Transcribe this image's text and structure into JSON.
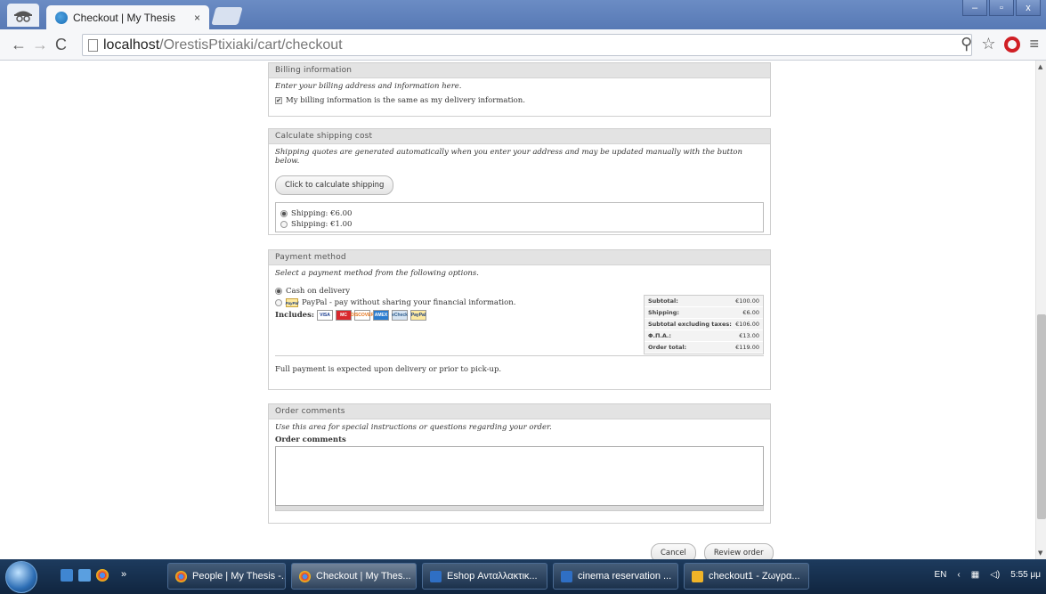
{
  "browser": {
    "tab_title": "Checkout | My Thesis",
    "tab_close": "×",
    "url_host": "localhost",
    "url_path": "/OrestisPtixiaki/cart/checkout",
    "win_min": "–",
    "win_max": "▫",
    "win_close": "x"
  },
  "billing": {
    "legend": "Billing information",
    "description": "Enter your billing address and information here.",
    "same_as_delivery": "My billing information is the same as my delivery information."
  },
  "shipping": {
    "legend": "Calculate shipping cost",
    "description": "Shipping quotes are generated automatically when you enter your address and may be updated manually with the button below.",
    "button": "Click to calculate shipping",
    "options": [
      {
        "label": "Shipping: €6.00",
        "selected": true
      },
      {
        "label": "Shipping: €1.00",
        "selected": false
      }
    ]
  },
  "payment": {
    "legend": "Payment method",
    "description": "Select a payment method from the following options.",
    "methods": [
      {
        "label": "Cash on delivery",
        "selected": true
      },
      {
        "label": "PayPal - pay without sharing your financial information.",
        "selected": false,
        "badge": "PayPal"
      }
    ],
    "includes_label": "Includes:",
    "cards": [
      "VISA",
      "MC",
      "DISCOVER",
      "AMEX",
      "eCheck",
      "PayPal"
    ],
    "note": "Full payment is expected upon delivery or prior to pick-up.",
    "totals": [
      {
        "label": "Subtotal:",
        "value": "€100.00"
      },
      {
        "label": "Shipping:",
        "value": "€6.00"
      },
      {
        "label": "Subtotal excluding taxes:",
        "value": "€106.00"
      },
      {
        "label": "Φ.Π.Α.:",
        "value": "€13.00"
      },
      {
        "label": "Order total:",
        "value": "€119.00"
      }
    ]
  },
  "comments": {
    "legend": "Order comments",
    "description": "Use this area for special instructions or questions regarding your order.",
    "field_label": "Order comments",
    "field_value": ""
  },
  "actions": {
    "cancel": "Cancel",
    "review": "Review order"
  },
  "taskbar": {
    "items": [
      {
        "label": "People | My Thesis -...",
        "active": false
      },
      {
        "label": "Checkout | My Thes...",
        "active": true
      },
      {
        "label": "Eshop Ανταλλακτικ...",
        "active": false
      },
      {
        "label": "cinema reservation ...",
        "active": false
      },
      {
        "label": "checkout1 - Ζωγρα...",
        "active": false
      }
    ],
    "lang": "EN",
    "clock": "5:55 μμ"
  },
  "colors": {
    "legend_bg": "#e3e3e3",
    "taskbar_bg": "#10253f",
    "titlebar_bg": "#5779b5"
  }
}
